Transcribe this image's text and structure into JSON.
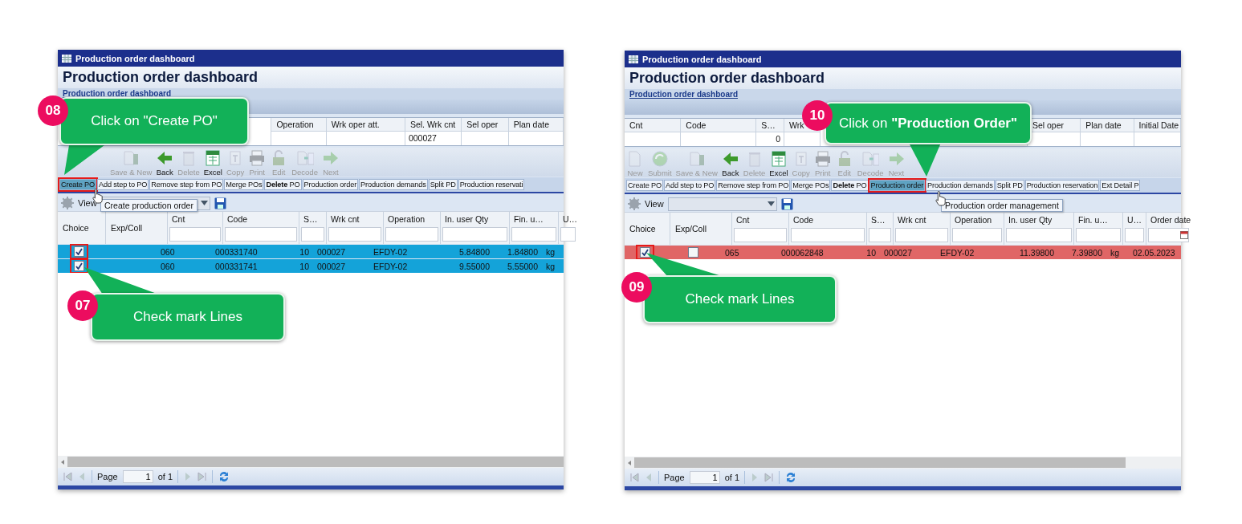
{
  "panels": [
    {
      "window_title": "Production order dashboard",
      "heading": "Production order dashboard",
      "breadcrumb": "Production order dashboard",
      "summary_columns": [
        {
          "label": "Operation"
        },
        {
          "label": "Wrk oper att."
        },
        {
          "label": "Sel. Wrk cnt",
          "value": "000027"
        },
        {
          "label": "Sel oper"
        },
        {
          "label": "Plan date"
        }
      ],
      "toolbar": [
        {
          "kind": "savenew",
          "label": "Save & New",
          "disabled": true
        },
        {
          "kind": "back",
          "label": "Back",
          "disabled": false
        },
        {
          "kind": "delete",
          "label": "Delete",
          "disabled": true
        },
        {
          "kind": "excel",
          "label": "Excel",
          "disabled": false
        },
        {
          "kind": "copy",
          "label": "Copy",
          "disabled": true
        },
        {
          "kind": "print",
          "label": "Print",
          "disabled": true
        },
        {
          "kind": "edit",
          "label": "Edit",
          "disabled": true
        },
        {
          "kind": "decode",
          "label": "Decode",
          "disabled": true
        },
        {
          "kind": "next",
          "label": "Next",
          "disabled": true
        }
      ],
      "actions": [
        {
          "label": "Create PO",
          "highlighted": true
        },
        {
          "label": "Add step to PO",
          "highlighted": false
        },
        {
          "label": "Remove step from PO",
          "highlighted": false
        },
        {
          "label": "Merge POs",
          "highlighted": false
        },
        {
          "label": "**Delete** PO",
          "highlighted": false
        },
        {
          "label": "Production order",
          "highlighted": false
        },
        {
          "label": "Production demands",
          "highlighted": false
        },
        {
          "label": "Split PD",
          "highlighted": false
        },
        {
          "label": "Production reservati",
          "highlighted": false
        }
      ],
      "view_label": "View",
      "columns": [
        "Choice",
        "Exp/Coll",
        "Cnt",
        "Code",
        "S…",
        "Wrk cnt",
        "Operation",
        "In. user Qty",
        "Fin. u…",
        "U…"
      ],
      "rows": [
        {
          "color": "#14a3d9",
          "checked": true,
          "marked": true,
          "cells": [
            "",
            "",
            "060",
            "000331740",
            "10",
            "000027",
            "EFDY-02",
            "5.84800",
            "1.84800",
            "kg"
          ]
        },
        {
          "color": "#14a3d9",
          "checked": true,
          "marked": true,
          "cells": [
            "",
            "",
            "060",
            "000331741",
            "10",
            "000027",
            "EFDY-02",
            "9.55000",
            "5.55000",
            "kg"
          ]
        }
      ],
      "tooltip": "Create production order",
      "pager": {
        "label": "Page",
        "value": "1",
        "total": "of 1"
      },
      "callouts": [
        {
          "number": "08",
          "text": "Click on \"Create PO\""
        },
        {
          "number": "07",
          "text": "Check mark Lines"
        }
      ]
    },
    {
      "window_title": "Production order dashboard",
      "heading": "Production order dashboard",
      "breadcrumb": "Production order dashboard",
      "summary_columns": [
        {
          "label": "Cnt"
        },
        {
          "label": "Code"
        },
        {
          "label": "S…",
          "value": "0"
        },
        {
          "label": "Wrk"
        },
        {
          "label": "Sel oper"
        },
        {
          "label": "Plan date"
        },
        {
          "label": "Initial Date"
        }
      ],
      "toolbar": [
        {
          "kind": "new",
          "label": "New",
          "disabled": true
        },
        {
          "kind": "submit",
          "label": "Submit",
          "disabled": true
        },
        {
          "kind": "savenew",
          "label": "Save & New",
          "disabled": true
        },
        {
          "kind": "back",
          "label": "Back",
          "disabled": false
        },
        {
          "kind": "delete",
          "label": "Delete",
          "disabled": true
        },
        {
          "kind": "excel",
          "label": "Excel",
          "disabled": false
        },
        {
          "kind": "copy",
          "label": "Copy",
          "disabled": true
        },
        {
          "kind": "print",
          "label": "Print",
          "disabled": true
        },
        {
          "kind": "edit",
          "label": "Edit",
          "disabled": true
        },
        {
          "kind": "decode",
          "label": "Decode",
          "disabled": true
        },
        {
          "kind": "next",
          "label": "Next",
          "disabled": true
        }
      ],
      "actions": [
        {
          "label": "Create PO",
          "highlighted": false
        },
        {
          "label": "Add step to PO",
          "highlighted": false
        },
        {
          "label": "Remove step from PO",
          "highlighted": false
        },
        {
          "label": "Merge POs",
          "highlighted": false
        },
        {
          "label": "**Delete** PO",
          "highlighted": false
        },
        {
          "label": "Production order",
          "highlighted": true
        },
        {
          "label": "Production demands",
          "highlighted": false
        },
        {
          "label": "Split PD",
          "highlighted": false
        },
        {
          "label": "Production reservation",
          "highlighted": false
        },
        {
          "label": "Ext Detail P",
          "highlighted": false
        }
      ],
      "view_label": "View",
      "columns": [
        "Choice",
        "Exp/Coll",
        "Cnt",
        "Code",
        "S…",
        "Wrk cnt",
        "Operation",
        "In. user Qty",
        "Fin. u…",
        "U…",
        "Order date"
      ],
      "rows": [
        {
          "color": "#e06666",
          "checked": true,
          "marked": true,
          "exp_checked": false,
          "cells": [
            "",
            "",
            "065",
            "000062848",
            "10",
            "000027",
            "EFDY-02",
            "11.39800",
            "7.39800",
            "kg",
            "02.05.2023"
          ]
        }
      ],
      "tooltip": "Production order management",
      "pager": {
        "label": "Page",
        "value": "1",
        "total": "of 1"
      },
      "callouts": [
        {
          "number": "10",
          "text": "Click on **\"Production Order\"**"
        },
        {
          "number": "09",
          "text": "Check mark Lines"
        }
      ]
    }
  ]
}
